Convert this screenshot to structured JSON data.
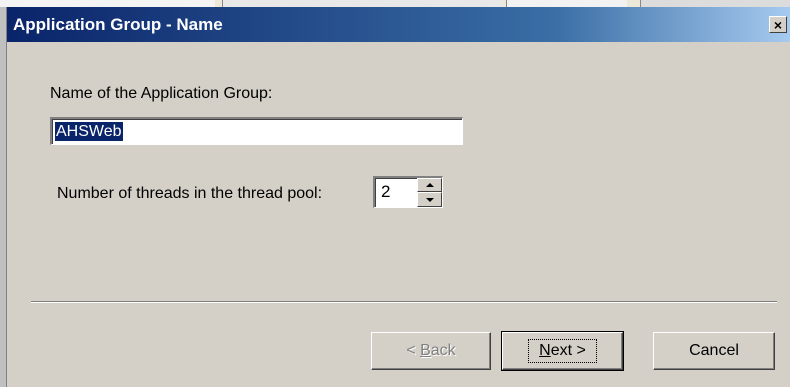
{
  "window": {
    "title": "Application Group - Name",
    "close_label": "×"
  },
  "form": {
    "name_label": "Name of the Application Group:",
    "name_value": "AHSWeb",
    "threads_label": "Number of threads in the thread pool:",
    "threads_value": "2"
  },
  "buttons": {
    "back_prefix": "< ",
    "back_mnemonic": "B",
    "back_rest": "ack",
    "next_mnemonic": "N",
    "next_rest": "ext >",
    "cancel": "Cancel"
  },
  "icons": {
    "spin_up": "triangle-up-icon",
    "spin_down": "triangle-down-icon",
    "close": "close-icon"
  },
  "colors": {
    "titlebar_start": "#0a246a",
    "titlebar_end": "#a6caf0",
    "face": "#d4d0c8",
    "selection": "#0a246a"
  }
}
